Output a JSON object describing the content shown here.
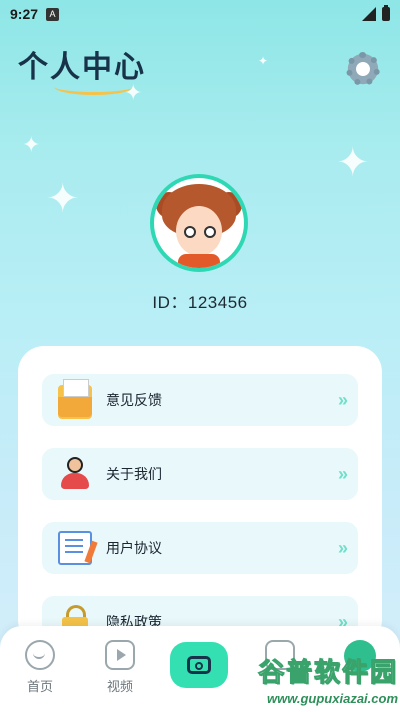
{
  "status": {
    "time": "9:27",
    "notification_badge": "A"
  },
  "header": {
    "title": "个人中心",
    "settings_icon": "gear-icon"
  },
  "profile": {
    "id_text": "ID：123456"
  },
  "menu": {
    "items": [
      {
        "label": "意见反馈",
        "icon": "envelope-icon"
      },
      {
        "label": "关于我们",
        "icon": "support-person-icon"
      },
      {
        "label": "用户协议",
        "icon": "document-icon"
      },
      {
        "label": "隐私政策",
        "icon": "lock-icon"
      }
    ]
  },
  "bottom_nav": {
    "items": [
      {
        "label": "首页",
        "icon": "home-icon"
      },
      {
        "label": "视频",
        "icon": "video-icon"
      },
      {
        "label": "",
        "icon": "camera-add-icon"
      },
      {
        "label": "",
        "icon": "search-icon"
      },
      {
        "label": "",
        "icon": "mine-icon"
      }
    ]
  },
  "watermark": {
    "text": "谷普软件园",
    "url": "www.gupuxiazai.com"
  },
  "colors": {
    "accent": "#34e0b2",
    "title": "#183349",
    "item_bg": "#e9f8fb"
  }
}
